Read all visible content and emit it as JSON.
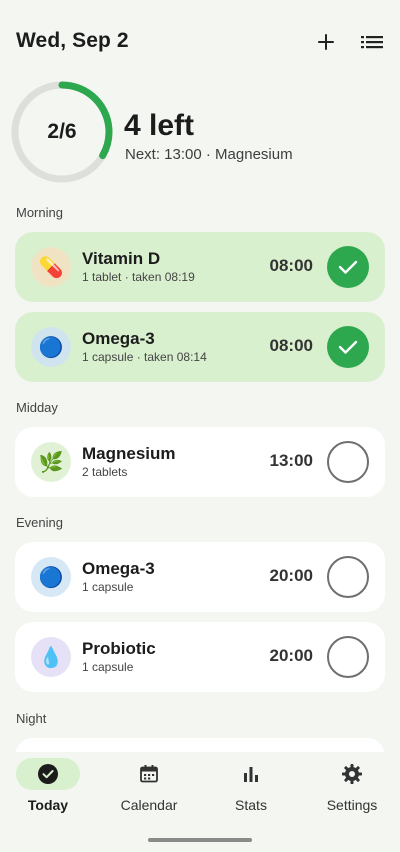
{
  "header": {
    "date": "Wed, Sep 2",
    "add_icon": "plus-icon",
    "list_icon": "list-icon"
  },
  "progress": {
    "taken_label": "2/6",
    "taken": 2,
    "total": 6,
    "left_text": "4 left",
    "next_text": "Next: 13:00 · Magnesium"
  },
  "sections": {
    "morning": "Morning",
    "midday": "Midday",
    "evening": "Evening",
    "night": "Night"
  },
  "doses": [
    {
      "name": "Vitamin D",
      "detail": "1 tablet · taken 08:19",
      "time": "08:00",
      "taken": true,
      "icon": "pill-icon",
      "glyph": "💊",
      "icon_bg": "#efe3c4"
    },
    {
      "name": "Omega-3",
      "detail": "1 capsule · taken 08:14",
      "time": "08:00",
      "taken": true,
      "icon": "capsule-icon",
      "glyph": "🔵",
      "icon_bg": "#cfe4ee"
    },
    {
      "name": "Magnesium",
      "detail": "2 tablets",
      "time": "13:00",
      "taken": false,
      "icon": "leaf-icon",
      "glyph": "🌿",
      "icon_bg": "#e1f1d6"
    },
    {
      "name": "Omega-3",
      "detail": "1 capsule",
      "time": "20:00",
      "taken": false,
      "icon": "capsule-icon",
      "glyph": "🔵",
      "icon_bg": "#d6e8f6"
    },
    {
      "name": "Probiotic",
      "detail": "1 capsule",
      "time": "20:00",
      "taken": false,
      "icon": "droplet-icon",
      "glyph": "💧",
      "icon_bg": "#e6e1f6"
    }
  ],
  "nav": {
    "today": "Today",
    "calendar": "Calendar",
    "stats": "Stats",
    "settings": "Settings"
  },
  "colors": {
    "accent": "#2ea84e",
    "taken_card": "#d9f0cf",
    "background": "#f3f6f1"
  }
}
